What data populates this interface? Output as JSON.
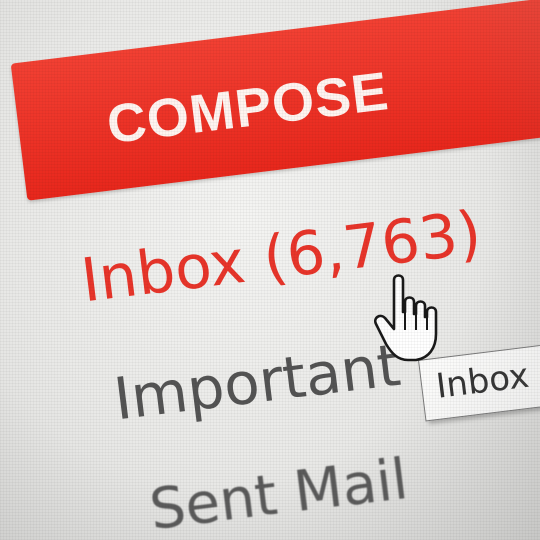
{
  "compose": {
    "label": "COMPOSE",
    "color": "#e8271c"
  },
  "nav": {
    "inbox": {
      "label": "Inbox (6,763)",
      "color": "#e8352a"
    },
    "important": {
      "label": "Important"
    },
    "sent": {
      "label": "Sent Mail"
    }
  },
  "tooltip": {
    "text": "Inbox"
  },
  "cursor": {
    "icon": "hand-pointer-icon"
  }
}
